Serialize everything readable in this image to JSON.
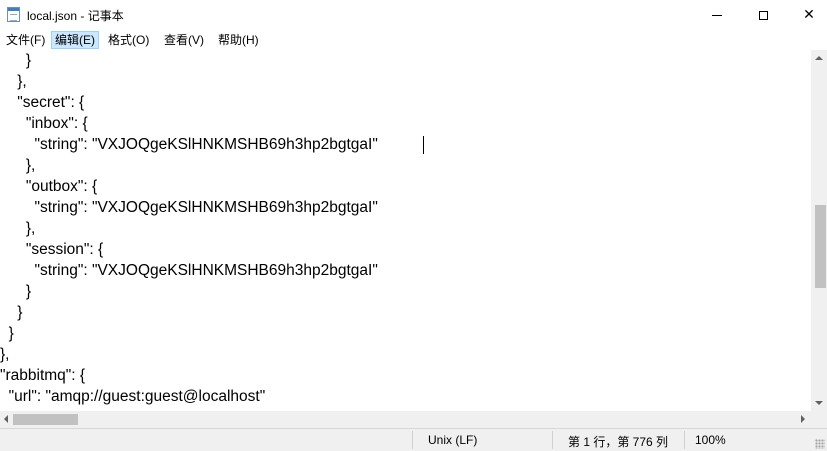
{
  "window": {
    "title": "local.json - 记事本",
    "close_glyph": "✕"
  },
  "menu": {
    "items": [
      "文件(F)",
      "编辑(E)",
      "格式(O)",
      "查看(V)",
      "帮助(H)"
    ],
    "active_index": 1
  },
  "editor": {
    "lines": [
      "      }",
      "    },",
      "    \"secret\": {",
      "      \"inbox\": {",
      "        \"string\": \"VXJOQgeKSlHNKMSHB69h3hp2bgtgaI\"",
      "      },",
      "      \"outbox\": {",
      "        \"string\": \"VXJOQgeKSlHNKMSHB69h3hp2bgtgaI\"",
      "      },",
      "      \"session\": {",
      "        \"string\": \"VXJOQgeKSlHNKMSHB69h3hp2bgtgaI\"",
      "      }",
      "    }",
      "  }",
      "},",
      "\"rabbitmq\": {",
      "  \"url\": \"amqp://guest:guest@localhost\""
    ]
  },
  "status": {
    "line_ending": "Unix (LF)",
    "position": "第 1 行，第 776 列",
    "zoom": "100%"
  },
  "icons": {
    "app": "notepad-icon",
    "minimize": "minimize-icon",
    "maximize": "maximize-icon",
    "close": "close-icon"
  }
}
